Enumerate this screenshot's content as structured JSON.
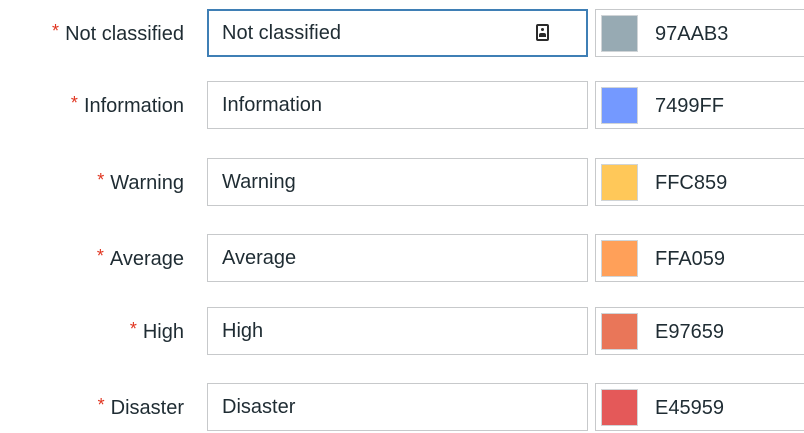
{
  "severities": [
    {
      "label": "Not classified",
      "value": "Not classified",
      "color_code": "97AAB3",
      "color": "#97AAB3",
      "required_mark": "*",
      "focused": true
    },
    {
      "label": "Information",
      "value": "Information",
      "color_code": "7499FF",
      "color": "#7499FF",
      "required_mark": "*",
      "focused": false
    },
    {
      "label": "Warning",
      "value": "Warning",
      "color_code": "FFC859",
      "color": "#FFC859",
      "required_mark": "*",
      "focused": false
    },
    {
      "label": "Average",
      "value": "Average",
      "color_code": "FFA059",
      "color": "#FFA059",
      "required_mark": "*",
      "focused": false
    },
    {
      "label": "High",
      "value": "High",
      "color_code": "E97659",
      "color": "#E97659",
      "required_mark": "*",
      "focused": false
    },
    {
      "label": "Disaster",
      "value": "Disaster",
      "color_code": "E45959",
      "color": "#E45959",
      "required_mark": "*",
      "focused": false
    }
  ],
  "theme": {
    "required_color": "#e0341f",
    "focus_border_color": "#3f7fb5",
    "input_border_color": "#c7c9cb"
  },
  "icons": {
    "focused_input_icon": "contact-card-icon"
  }
}
